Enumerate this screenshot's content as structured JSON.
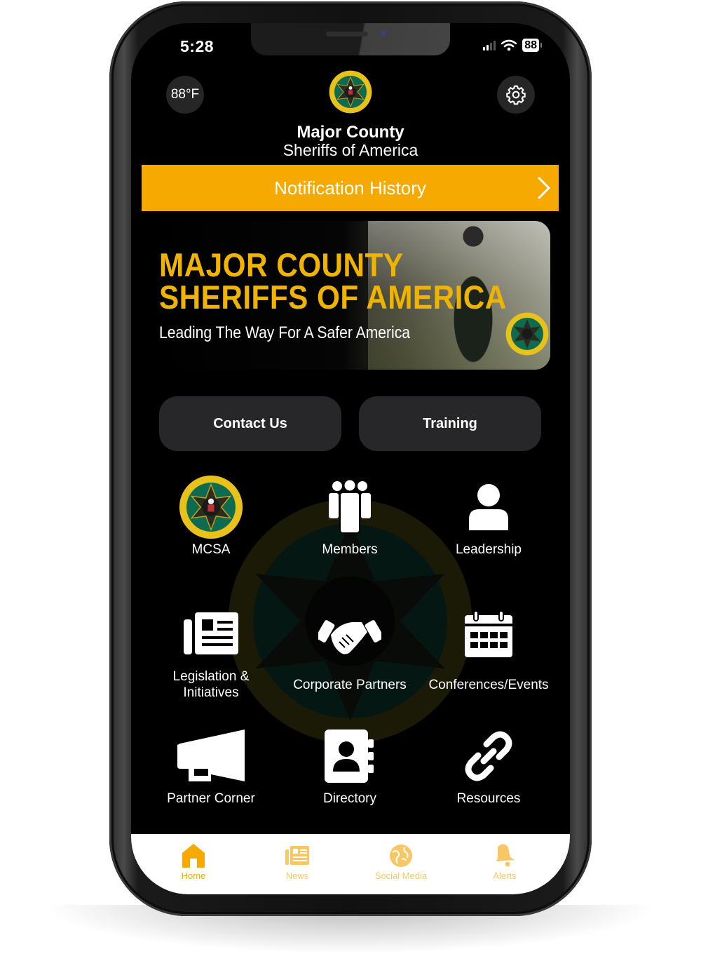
{
  "status_bar": {
    "time": "5:28",
    "battery": "88"
  },
  "header": {
    "weather": "88°F",
    "title_line1": "Major County",
    "title_line2": "Sheriffs of America",
    "settings_icon": "gear-icon"
  },
  "notification_bar": {
    "label": "Notification History"
  },
  "banner": {
    "headline_line1": "MAJOR COUNTY",
    "headline_line2": "SHERIFFS OF AMERICA",
    "tagline": "Leading The Way For A Safer America"
  },
  "buttons": {
    "contact": "Contact Us",
    "training": "Training"
  },
  "grid": [
    {
      "label": "MCSA",
      "icon": "seal-icon"
    },
    {
      "label": "Members",
      "icon": "group-icon"
    },
    {
      "label": "Leadership",
      "icon": "person-icon"
    },
    {
      "label": "Legislation &",
      "label2": "Initiatives",
      "icon": "newspaper-icon"
    },
    {
      "label": "Corporate Partners",
      "icon": "handshake-icon"
    },
    {
      "label": "Conferences/Events",
      "icon": "calendar-icon"
    },
    {
      "label": "Partner Corner",
      "icon": "megaphone-icon"
    },
    {
      "label": "Directory",
      "icon": "contact-book-icon"
    },
    {
      "label": "Resources",
      "icon": "link-icon"
    }
  ],
  "tabbar": [
    {
      "label": "Home",
      "active": true
    },
    {
      "label": "News",
      "active": false
    },
    {
      "label": "Social Media",
      "active": false
    },
    {
      "label": "Alerts",
      "active": false
    }
  ],
  "colors": {
    "accent": "#f6a900",
    "accent_inactive": "#f7c765",
    "pill_bg": "#272628",
    "seal_green": "#0f6b50",
    "seal_gold": "#e8c21a"
  }
}
